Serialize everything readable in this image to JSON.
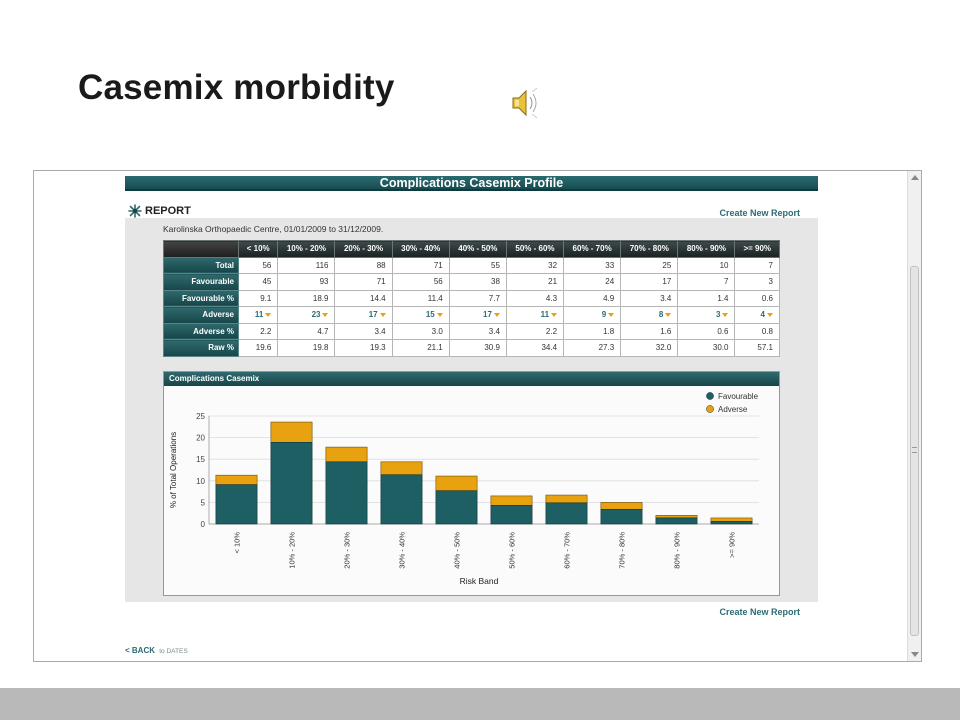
{
  "slide": {
    "title": "Casemix morbidity"
  },
  "app": {
    "header_title": "Complications Casemix Profile",
    "report_label": "REPORT",
    "create_report_link": "Create New Report",
    "centre_text": "Karolinska Orthopaedic Centre, 01/01/2009 to 31/12/2009.",
    "back_label": "< BACK",
    "back_target": "to DATES"
  },
  "table": {
    "columns": [
      "< 10%",
      "10% - 20%",
      "20% - 30%",
      "30% - 40%",
      "40% - 50%",
      "50% - 60%",
      "60% - 70%",
      "70% - 80%",
      "80% - 90%",
      ">= 90%"
    ],
    "rows": [
      {
        "label": "Total",
        "values": [
          "56",
          "116",
          "88",
          "71",
          "55",
          "32",
          "33",
          "25",
          "10",
          "7"
        ]
      },
      {
        "label": "Favourable",
        "values": [
          "45",
          "93",
          "71",
          "56",
          "38",
          "21",
          "24",
          "17",
          "7",
          "3"
        ]
      },
      {
        "label": "Favourable %",
        "values": [
          "9.1",
          "18.9",
          "14.4",
          "11.4",
          "7.7",
          "4.3",
          "4.9",
          "3.4",
          "1.4",
          "0.6"
        ]
      },
      {
        "label": "Adverse",
        "values": [
          "11",
          "23",
          "17",
          "15",
          "17",
          "11",
          "9",
          "8",
          "3",
          "4"
        ]
      },
      {
        "label": "Adverse %",
        "values": [
          "2.2",
          "4.7",
          "3.4",
          "3.0",
          "3.4",
          "2.2",
          "1.8",
          "1.6",
          "0.6",
          "0.8"
        ]
      },
      {
        "label": "Raw %",
        "values": [
          "19.6",
          "19.8",
          "19.3",
          "21.1",
          "30.9",
          "34.4",
          "27.3",
          "32.0",
          "30.0",
          "57.1"
        ]
      }
    ]
  },
  "colors": {
    "teal": "#1e5f63",
    "orange": "#e8a10f",
    "header_teal": "#174649"
  },
  "icons": {
    "speaker": "speaker-icon",
    "report": "report-icon",
    "adverse_marker": "down-arrow-icon"
  },
  "chart_data": {
    "type": "bar",
    "stacked": true,
    "title": "Complications Casemix",
    "xlabel": "Risk Band",
    "ylabel": "% of Total Operations",
    "categories": [
      "< 10%",
      "10% - 20%",
      "20% - 30%",
      "30% - 40%",
      "40% - 50%",
      "50% - 60%",
      "60% - 70%",
      "70% - 80%",
      "80% - 90%",
      ">= 90%"
    ],
    "series": [
      {
        "name": "Favourable",
        "color": "#1e5f63",
        "values": [
          9.1,
          18.9,
          14.4,
          11.4,
          7.7,
          4.3,
          4.9,
          3.4,
          1.4,
          0.6
        ]
      },
      {
        "name": "Adverse",
        "color": "#e8a10f",
        "values": [
          2.2,
          4.7,
          3.4,
          3.0,
          3.4,
          2.2,
          1.8,
          1.6,
          0.6,
          0.8
        ]
      }
    ],
    "ylim": [
      0,
      25
    ],
    "yticks": [
      0,
      5,
      10,
      15,
      20,
      25
    ],
    "grid": true,
    "legend": "top-right"
  }
}
